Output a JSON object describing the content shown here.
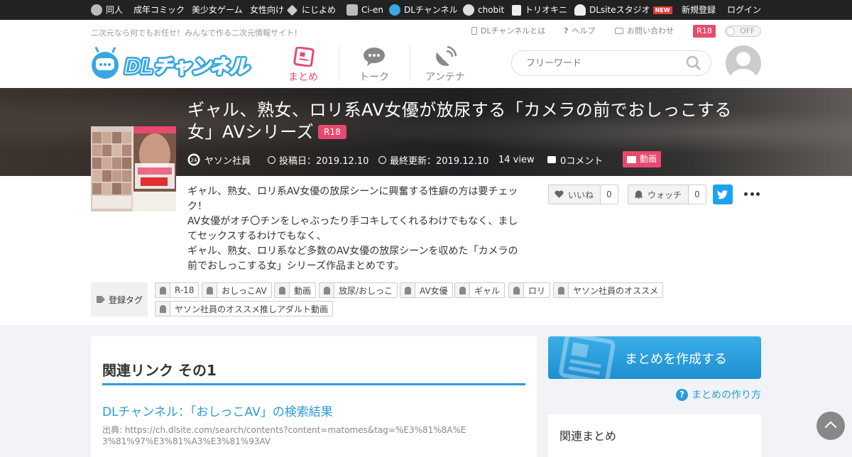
{
  "topnav": {
    "items": [
      "同人",
      "成年コミック",
      "美少女ゲーム",
      "女性向け",
      "にじよめ",
      "Ci-en",
      "DLチャンネル",
      "chobit",
      "トリオキニ",
      "DLsiteスタジオ"
    ],
    "new_badge": "NEW",
    "register": "新規登録",
    "login": "ログイン"
  },
  "header": {
    "tagline": "二次元なら何でもお任せ！みんなで作る二次元情報サイト！",
    "links": [
      "DLチャンネルとは",
      "ヘルプ",
      "お問い合わせ"
    ],
    "r18": "R18",
    "toggle": "OFF",
    "logo_text": "DLチャンネル",
    "tabs": [
      "まとめ",
      "トーク",
      "アンテナ"
    ],
    "search_placeholder": "フリーワード"
  },
  "article": {
    "title": "ギャル、熟女、ロリ系AV女優が放尿する「カメラの前でおしっこする女」AVシリーズ",
    "r18": "R18",
    "author": "ヤソン社員",
    "posted": "投稿日：2019.12.10",
    "updated": "最終更新：2019.12.10",
    "views": "14 view",
    "comments": "0コメント",
    "category": "動画",
    "description": [
      "ギャル、熟女、ロリ系AV女優の放尿シーンに興奮する性癖の方は要チェック！",
      "AV女優がオチ〇チンをしゃぶったり手コキしてくれるわけでもなく、ましてセックスするわけでもなく、",
      "ギャル、熟女、ロリ系など多数のAV女優の放尿シーンを収めた「カメラの前でおしっこする女」シリーズ作品まとめです。"
    ],
    "like_label": "いいね",
    "like_count": "0",
    "watch_label": "ウォッチ",
    "watch_count": "0",
    "tag_label": "登録タグ",
    "tags": [
      "R-18",
      "おしっこAV",
      "動画",
      "放尿/おしっこ",
      "AV女優",
      "ギャル",
      "ロリ",
      "ヤソン社員のオススメ",
      "ヤソン社員のオススメ推しアダルト動画"
    ]
  },
  "related": {
    "heading": "関連リンク その1",
    "link": "DLチャンネル：「おしっこAV」の検索結果",
    "source": "出典: https://ch.dlsite.com/search/contents?content=matomes&tag=%E3%81%8A%E3%81%97%E3%81%A3%E3%81%93AV"
  },
  "sidebar": {
    "create": "まとめを作成する",
    "howto": "まとめの作り方",
    "related_heading": "関連まとめ"
  },
  "colors": {
    "accent_pink": "#e84a6f",
    "accent_blue": "#2a9bd7",
    "topbar": "#222222"
  }
}
